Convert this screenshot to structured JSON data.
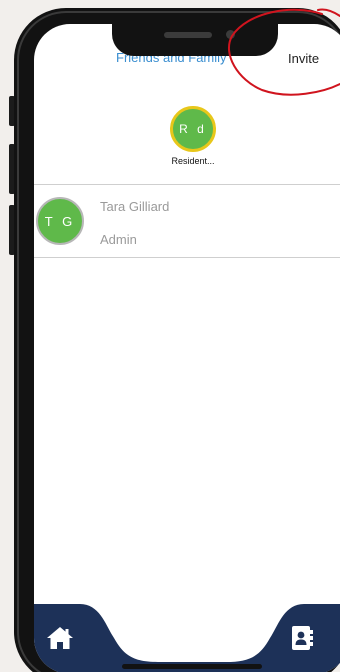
{
  "header": {
    "title": "Friends and Family",
    "invite_label": "Invite"
  },
  "resident": {
    "initials": "R d",
    "name": "Resident..."
  },
  "members": [
    {
      "initials": "T G",
      "name": "Tara Gilliard",
      "role": "Admin"
    }
  ],
  "bottom_nav": {
    "items": [
      {
        "icon": "home-icon"
      },
      {
        "icon": "contacts-icon"
      }
    ]
  },
  "colors": {
    "title": "#3a8ed0",
    "nav_bar": "#1d3158",
    "avatar_green": "#5fb94a",
    "resident_ring": "#e8c71a",
    "annotation_red": "#d0141e"
  }
}
